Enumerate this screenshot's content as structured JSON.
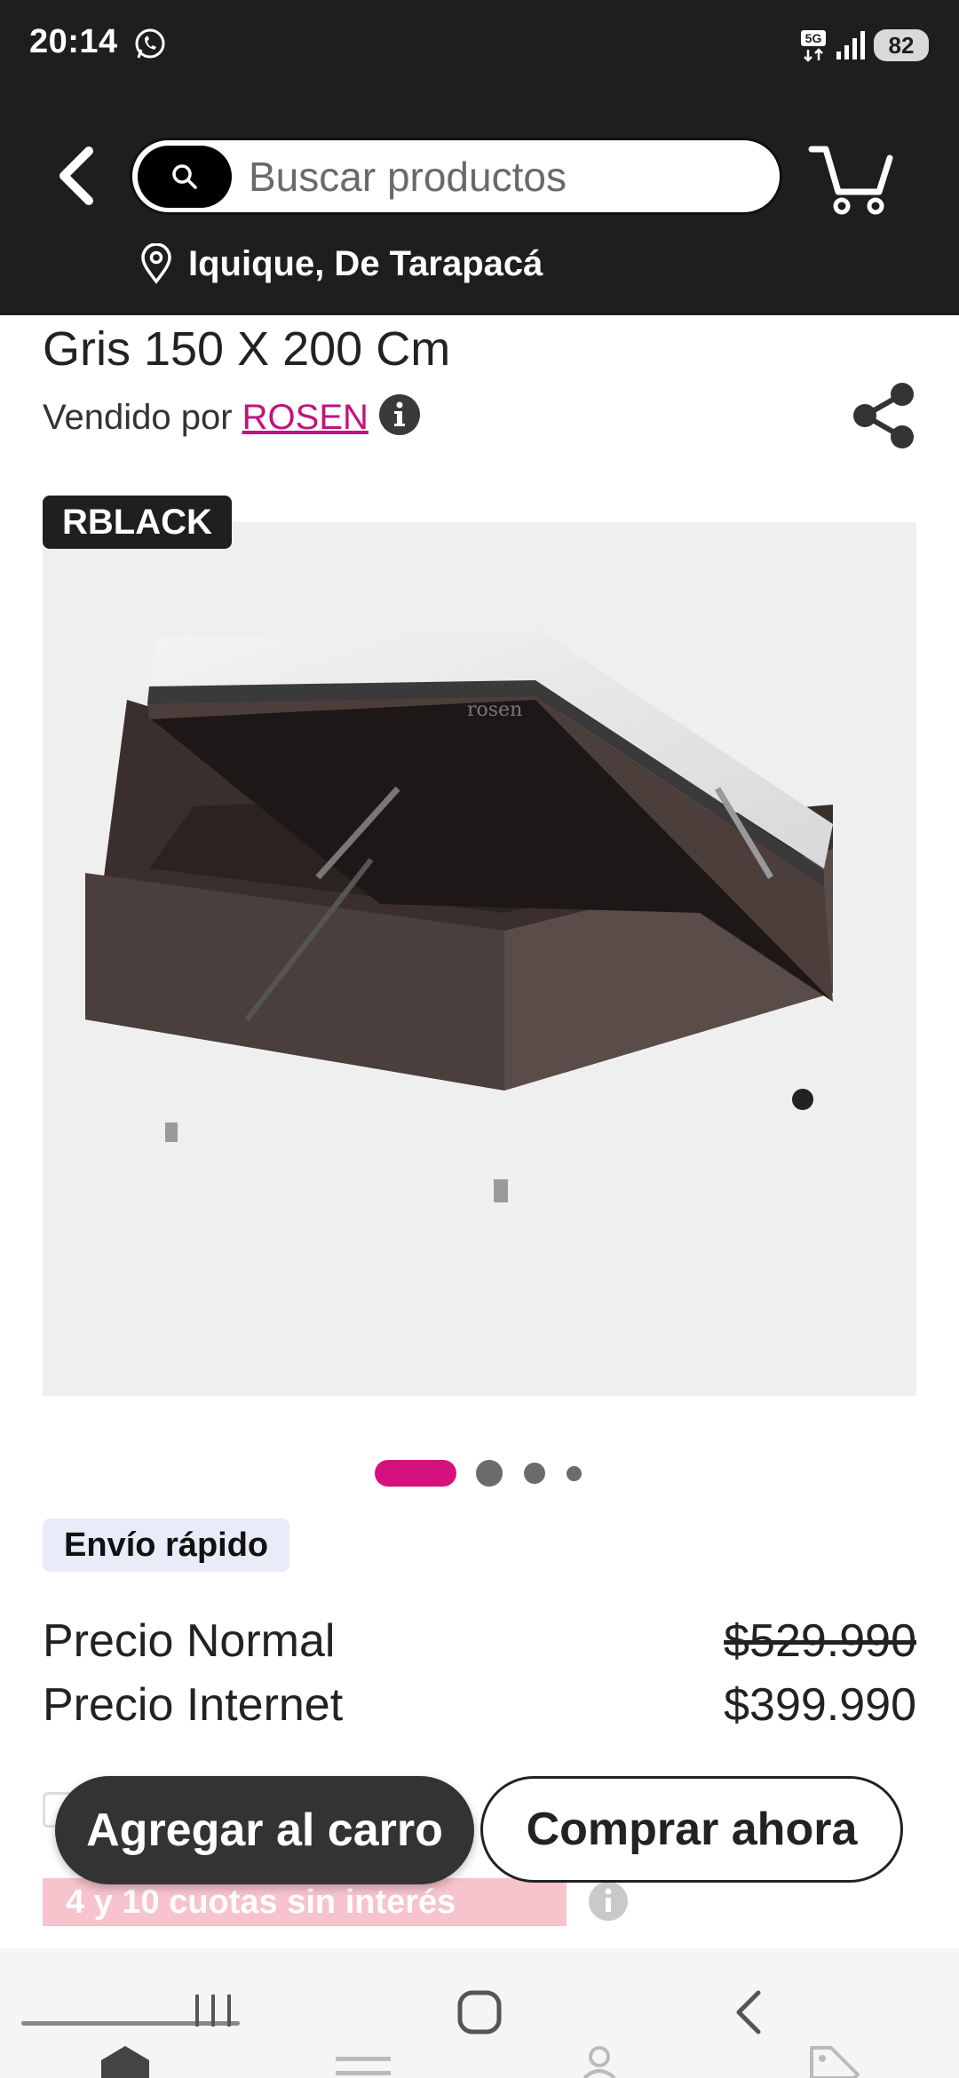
{
  "status_bar": {
    "time": "20:14",
    "network": "5G",
    "battery": "82"
  },
  "header": {
    "search_placeholder": "Buscar productos",
    "location": "Iquique, De Tarapacá"
  },
  "product": {
    "title": "Gris 150 X 200 Cm",
    "seller_prefix": "Vendido por ",
    "seller_name": "ROSEN",
    "badge": "RBLACK",
    "image_brand": "rosen",
    "image_count": 4,
    "active_image": 1,
    "shipping_tag": "Envío rápido",
    "prices": [
      {
        "label": "Precio Normal",
        "value": "$529.990",
        "struck": true
      },
      {
        "label": "Precio Internet",
        "value": "$399.990",
        "struck": false
      }
    ],
    "promo": "4 y 10 cuotas sin interés"
  },
  "actions": {
    "add_to_cart": "Agregar al carro",
    "buy_now": "Comprar ahora"
  },
  "colors": {
    "header_bg": "#1e1e1e",
    "accent": "#d4117f",
    "button_dark": "#333333"
  }
}
